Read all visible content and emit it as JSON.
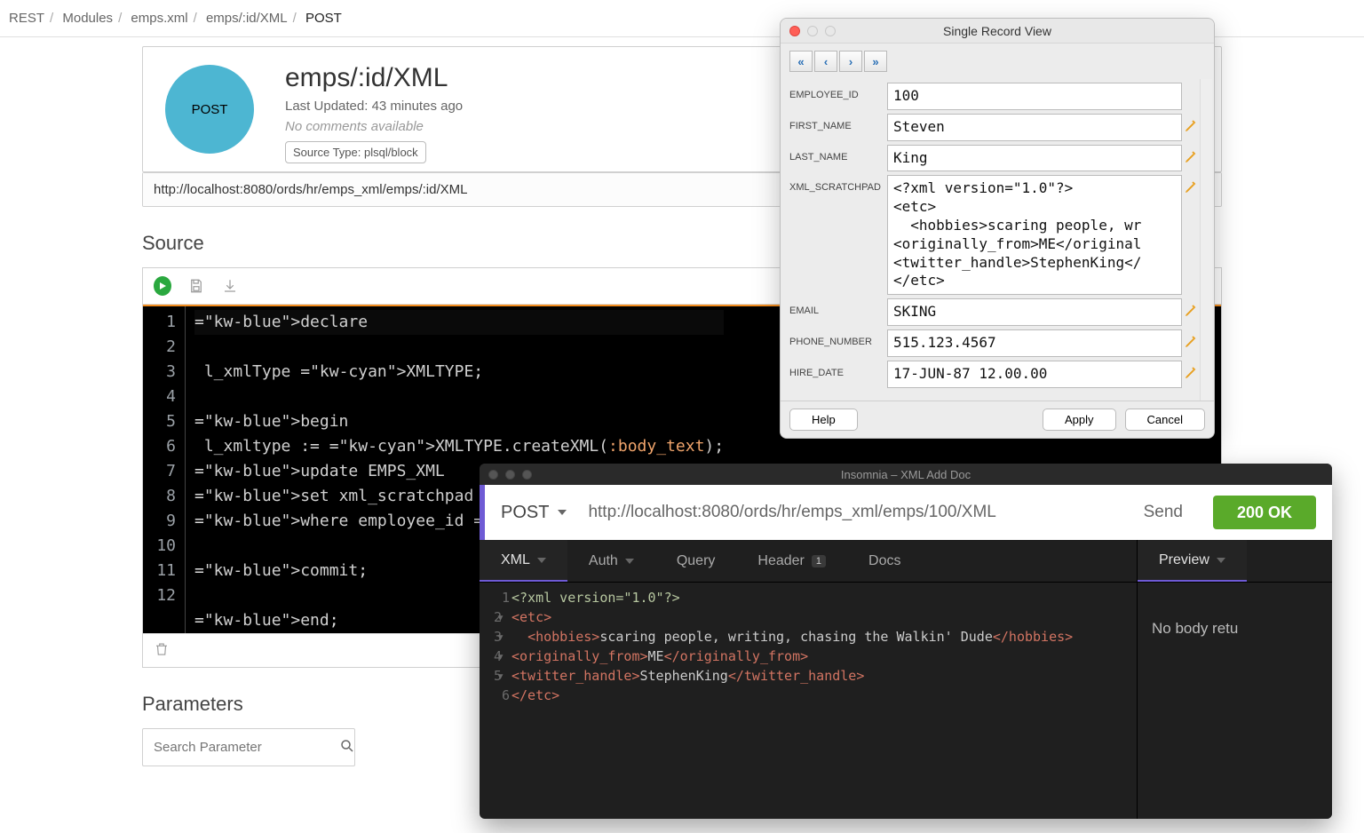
{
  "breadcrumb": [
    "REST",
    "Modules",
    "emps.xml",
    "emps/:id/XML",
    "POST"
  ],
  "header": {
    "method": "POST",
    "title": "emps/:id/XML",
    "last_updated": "Last Updated: 43 minutes ago",
    "comments": "No comments available",
    "source_chip": "Source Type: plsql/block",
    "url": "http://localhost:8080/ords/hr/emps_xml/emps/:id/XML"
  },
  "sections": {
    "source": "Source",
    "parameters": "Parameters"
  },
  "code_lines": [
    "declare",
    " l_xmlType XMLTYPE;",
    "",
    "begin",
    " l_xmltype := XMLTYPE.createXML(:body_text);",
    "update EMPS_XML",
    "set xml_scratchpad = l_xmltype",
    "where employee_id = :id;",
    "",
    "commit;",
    "",
    "end;"
  ],
  "param_search_placeholder": "Search Parameter",
  "srv": {
    "title": "Single Record View",
    "nav": [
      "«",
      "‹",
      "›",
      "»"
    ],
    "fields": [
      {
        "label": "EMPLOYEE_ID",
        "value": "100",
        "editable": false
      },
      {
        "label": "FIRST_NAME",
        "value": "Steven",
        "editable": true
      },
      {
        "label": "LAST_NAME",
        "value": "King",
        "editable": true
      },
      {
        "label": "XML_SCRATCHPAD",
        "value": "<?xml version=\"1.0\"?>\n<etc>\n  <hobbies>scaring people, wr\n<originally_from>ME</original\n<twitter_handle>StephenKing</\n</etc>",
        "editable": true
      },
      {
        "label": "EMAIL",
        "value": "SKING",
        "editable": true
      },
      {
        "label": "PHONE_NUMBER",
        "value": "515.123.4567",
        "editable": true
      },
      {
        "label": "HIRE_DATE",
        "value": "17-JUN-87 12.00.00",
        "editable": true
      }
    ],
    "buttons": {
      "help": "Help",
      "apply": "Apply",
      "cancel": "Cancel"
    }
  },
  "insomnia": {
    "title": "Insomnia – XML Add Doc",
    "method": "POST",
    "url": "http://localhost:8080/ords/hr/emps_xml/emps/100/XML",
    "send": "Send",
    "status": "200 OK",
    "tabs": {
      "body": "XML",
      "auth": "Auth",
      "query": "Query",
      "header": "Header",
      "header_badge": "1",
      "docs": "Docs"
    },
    "preview": "Preview",
    "no_body": "No body retu",
    "body_lines": [
      {
        "n": "1",
        "fold": "",
        "pre": "<?xml version=\"1.0\"?>"
      },
      {
        "n": "2",
        "fold": "▾",
        "open": "<etc>"
      },
      {
        "n": "3",
        "fold": "▾",
        "indent": "  ",
        "open": "<hobbies>",
        "text": "scaring people, writing, chasing the Walkin' Dude",
        "close": "</hobbies>"
      },
      {
        "n": "4",
        "fold": "▾",
        "open": "<originally_from>",
        "text": "ME",
        "close": "</originally_from>"
      },
      {
        "n": "5",
        "fold": "▾",
        "open": "<twitter_handle>",
        "text": "StephenKing",
        "close": "</twitter_handle>"
      },
      {
        "n": "6",
        "fold": "",
        "open": "</etc>"
      }
    ]
  }
}
